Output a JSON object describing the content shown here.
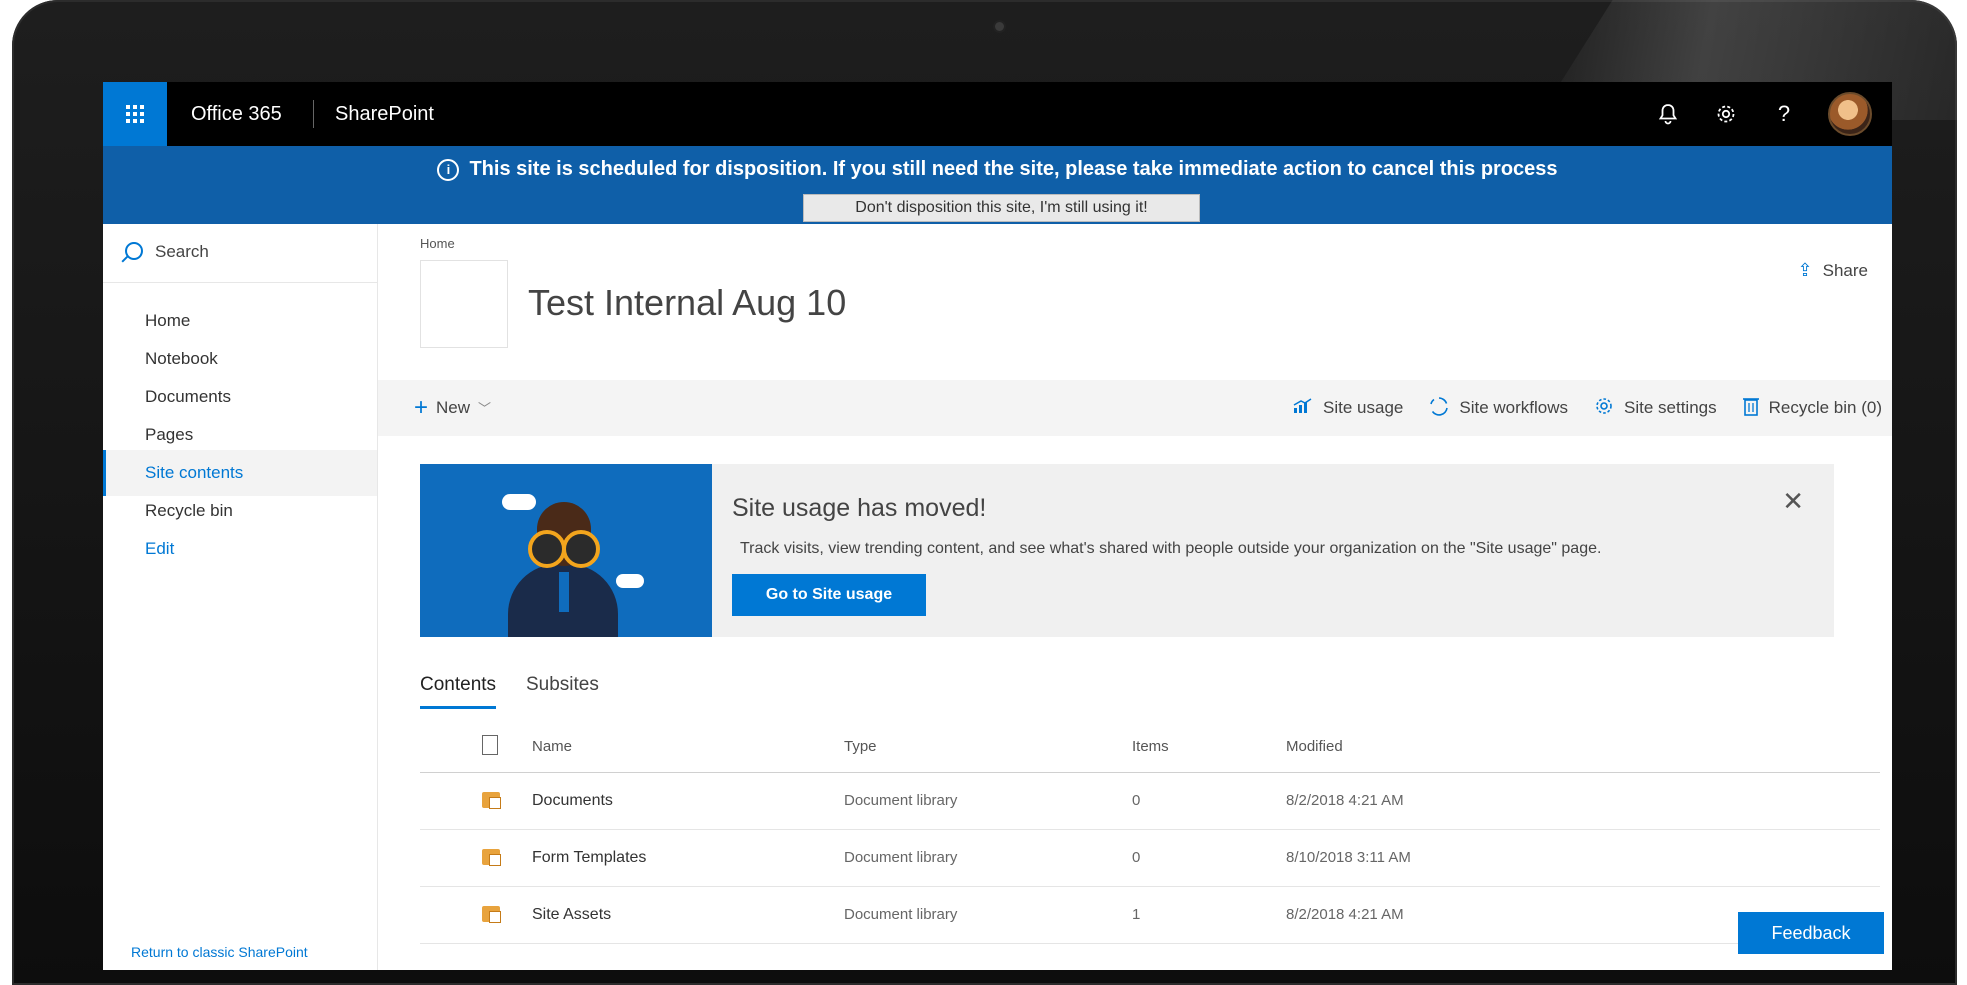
{
  "suite": {
    "brand": "Office 365",
    "app_name": "SharePoint",
    "icons": [
      "bell-icon",
      "gear-icon",
      "help-icon",
      "avatar"
    ],
    "accent": "#0078d4"
  },
  "banner": {
    "message": "This site is scheduled for disposition.  If you still need the site, please take immediate action to cancel this process",
    "button_label": "Don't disposition this site, I'm still using it!",
    "color": "#0f5fa8"
  },
  "leftnav": {
    "search_label": "Search",
    "items": [
      {
        "label": "Home"
      },
      {
        "label": "Notebook"
      },
      {
        "label": "Documents"
      },
      {
        "label": "Pages"
      },
      {
        "label": "Site contents"
      },
      {
        "label": "Recycle bin"
      },
      {
        "label": "Edit"
      }
    ],
    "return_link": "Return to classic SharePoint"
  },
  "header": {
    "breadcrumb": "Home",
    "title": "Test Internal Aug 10",
    "share_label": "Share"
  },
  "commandbar": {
    "new_label": "New",
    "site_usage": "Site usage",
    "site_workflows": "Site workflows",
    "site_settings": "Site settings",
    "recycle_bin": "Recycle bin (0)"
  },
  "promo": {
    "title": "Site usage has moved!",
    "description": "Track visits, view trending content, and see what's shared with people outside your organization on the \"Site usage\" page.",
    "button_label": "Go to Site usage"
  },
  "tabs": {
    "contents": "Contents",
    "subsites": "Subsites"
  },
  "table": {
    "columns": {
      "name": "Name",
      "type": "Type",
      "items": "Items",
      "modified": "Modified"
    },
    "rows": [
      {
        "name": "Documents",
        "type": "Document library",
        "items": "0",
        "modified": "8/2/2018 4:21 AM"
      },
      {
        "name": "Form Templates",
        "type": "Document library",
        "items": "0",
        "modified": "8/10/2018 3:11 AM"
      },
      {
        "name": "Site Assets",
        "type": "Document library",
        "items": "1",
        "modified": "8/2/2018 4:21 AM"
      }
    ]
  },
  "feedback_label": "Feedback"
}
